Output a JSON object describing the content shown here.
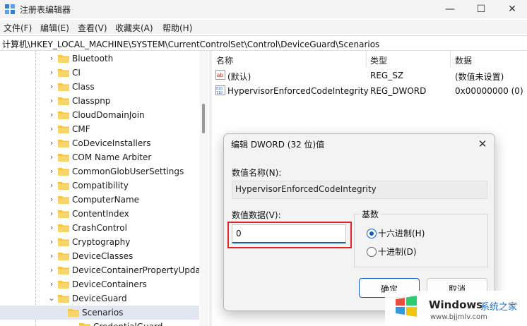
{
  "window": {
    "title": "注册表编辑器",
    "icons": {
      "app": "regedit-icon",
      "minimize": "minimize-icon",
      "maximize": "maximize-icon",
      "close": "close-icon"
    }
  },
  "menu": [
    {
      "label": "文件(F)"
    },
    {
      "label": "编辑(E)"
    },
    {
      "label": "查看(V)"
    },
    {
      "label": "收藏夹(A)"
    },
    {
      "label": "帮助(H)"
    }
  ],
  "address": "计算机\\HKEY_LOCAL_MACHINE\\SYSTEM\\CurrentControlSet\\Control\\DeviceGuard\\Scenarios",
  "tree": {
    "nodes": [
      {
        "label": "Bluetooth",
        "expanded": false
      },
      {
        "label": "CI",
        "expanded": false
      },
      {
        "label": "Class",
        "expanded": false
      },
      {
        "label": "Classpnp",
        "expanded": false
      },
      {
        "label": "CloudDomainJoin",
        "expanded": false
      },
      {
        "label": "CMF",
        "expanded": false
      },
      {
        "label": "CoDeviceInstallers",
        "expanded": false
      },
      {
        "label": "COM Name Arbiter",
        "expanded": false
      },
      {
        "label": "CommonGlobUserSettings",
        "expanded": false
      },
      {
        "label": "Compatibility",
        "expanded": false
      },
      {
        "label": "ComputerName",
        "expanded": false
      },
      {
        "label": "ContentIndex",
        "expanded": false
      },
      {
        "label": "CrashControl",
        "expanded": false
      },
      {
        "label": "Cryptography",
        "expanded": false
      },
      {
        "label": "DeviceClasses",
        "expanded": false
      },
      {
        "label": "DeviceContainerPropertyUpda",
        "expanded": false
      },
      {
        "label": "DeviceContainers",
        "expanded": false
      },
      {
        "label": "DeviceGuard",
        "expanded": true
      },
      {
        "label": "Scenarios",
        "expanded": true,
        "selected": true,
        "child": true
      },
      {
        "label": "CredentialGuard",
        "expanded": false,
        "grandchild": true
      }
    ]
  },
  "list": {
    "columns": [
      "名称",
      "类型",
      "数据"
    ],
    "rows": [
      {
        "icon": "string-value-icon",
        "name": "(默认)",
        "type": "REG_SZ",
        "data": "(数值未设置)"
      },
      {
        "icon": "binary-value-icon",
        "name": "HypervisorEnforcedCodeIntegrity",
        "type": "REG_DWORD",
        "data": "0x00000000 (0)"
      }
    ]
  },
  "dialog": {
    "title": "编辑 DWORD (32 位)值",
    "name_label": "数值名称(N):",
    "name_value": "HypervisorEnforcedCodeIntegrity",
    "data_label": "数值数据(V):",
    "data_value": "0",
    "base_label": "基数",
    "hex_label": "十六进制(H)",
    "dec_label": "十进制(D)",
    "hex_selected": true,
    "ok_label": "确定",
    "cancel_label": "取消"
  },
  "watermark": {
    "line1": "Windows",
    "line2": "系统之家",
    "line3": "www.bjjmlv.com"
  },
  "colors": {
    "accent": "#0f5ec7",
    "highlight_box": "#e12424",
    "folder": "#f4c542"
  }
}
